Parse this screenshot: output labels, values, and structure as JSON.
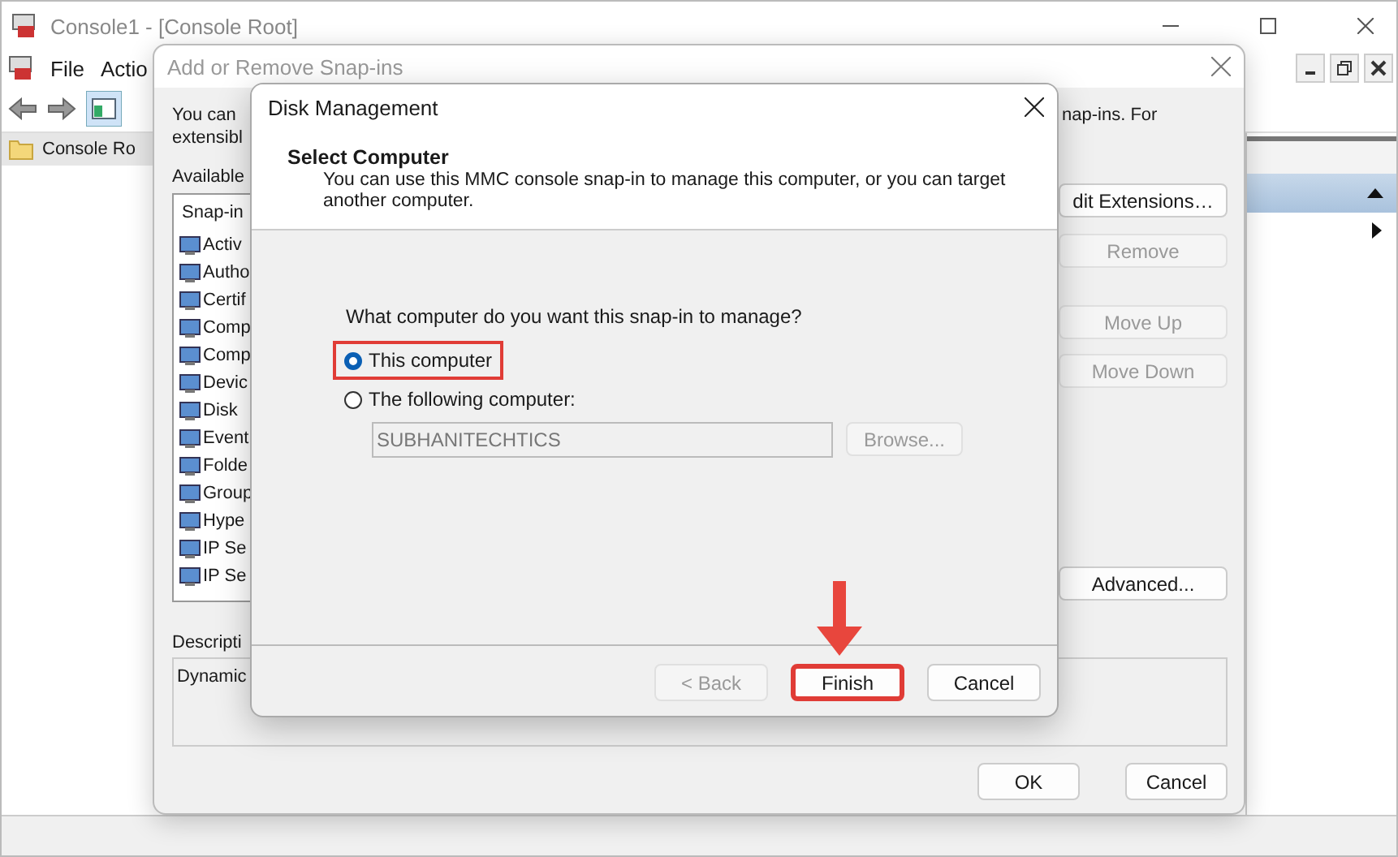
{
  "console": {
    "title": "Console1 - [Console Root]",
    "menu": [
      "File",
      "Actio"
    ],
    "tree": [
      {
        "label": "Console Ro",
        "selected": true
      }
    ]
  },
  "snapins_dialog": {
    "title": "Add or Remove Snap-ins",
    "intro_lines": [
      "You can",
      "extensibl"
    ],
    "intro_right": "nap-ins. For",
    "available_label": "Available",
    "list_header": "Snap-in",
    "items": [
      {
        "label": "Activ"
      },
      {
        "label": "Autho"
      },
      {
        "label": "Certif"
      },
      {
        "label": "Comp"
      },
      {
        "label": "Comp"
      },
      {
        "label": "Devic"
      },
      {
        "label": "Disk"
      },
      {
        "label": "Event"
      },
      {
        "label": "Folde"
      },
      {
        "label": "Group"
      },
      {
        "label": "Hype"
      },
      {
        "label": "IP Se"
      },
      {
        "label": "IP Se"
      }
    ],
    "side_buttons": [
      {
        "label": "dit Extensions…",
        "disabled": false
      },
      {
        "label": "Remove",
        "disabled": true
      },
      {
        "label": "Move Up",
        "disabled": true
      },
      {
        "label": "Move Down",
        "disabled": true
      },
      {
        "label": "Advanced...",
        "disabled": false
      }
    ],
    "description_label": "Descripti",
    "description": "Dynamic",
    "buttons": [
      "OK",
      "Cancel"
    ]
  },
  "wizard": {
    "title": "Disk Management",
    "heading": "Select Computer",
    "subtitle": "You can use this MMC console snap-in to manage this computer, or you can target another computer.",
    "question": "What computer do you want this snap-in to manage?",
    "options": [
      {
        "label": "This computer",
        "selected": true,
        "highlighted": true
      },
      {
        "label": "The following computer:",
        "selected": false,
        "highlighted": false
      }
    ],
    "computer_field": {
      "value": "SUBHANITECHTICS",
      "disabled": true
    },
    "browse": {
      "label": "Browse...",
      "disabled": true
    },
    "buttons": [
      {
        "label": "< Back",
        "disabled": true,
        "highlighted": false
      },
      {
        "label": "Finish",
        "disabled": false,
        "highlighted": true
      },
      {
        "label": "Cancel",
        "disabled": false,
        "highlighted": false
      }
    ]
  }
}
